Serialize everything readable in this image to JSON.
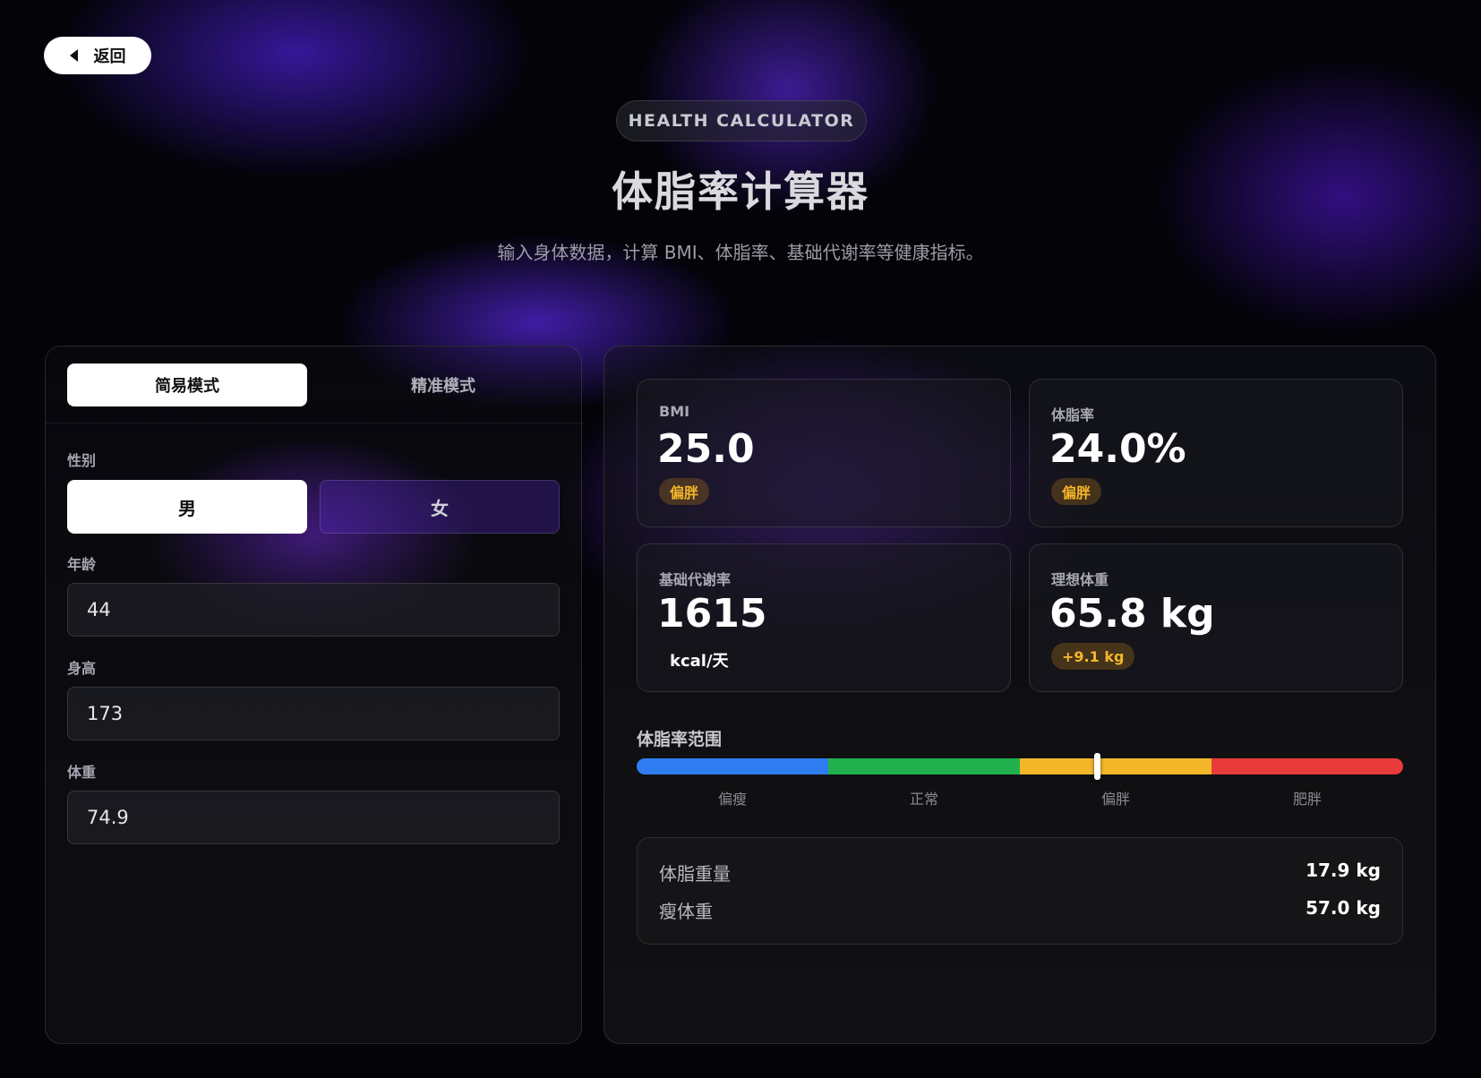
{
  "nav": {
    "back_label": "返回"
  },
  "header": {
    "eyebrow": "HEALTH CALCULATOR",
    "title": "体脂率计算器",
    "subtitle": "输入身体数据，计算 BMI、体脂率、基础代谢率等健康指标。"
  },
  "modes": {
    "simple": "简易模式",
    "precise": "精准模式",
    "selected": "简易模式"
  },
  "form": {
    "gender_label": "性别",
    "gender_options": [
      "男",
      "女"
    ],
    "gender_selected": "男",
    "age_label": "年龄",
    "age_value": "44",
    "height_label": "身高",
    "height_value": "173",
    "weight_label": "体重",
    "weight_value": "74.9"
  },
  "results": {
    "bmi": {
      "label": "BMI",
      "value": "25.0",
      "badge": "偏胖"
    },
    "body_fat": {
      "label": "体脂率",
      "value": "24.0%",
      "badge": "偏胖"
    },
    "bmr": {
      "label": "基础代谢率",
      "value": "1615",
      "unit": "kcal/天"
    },
    "ideal_weight": {
      "label": "理想体重",
      "value": "65.8 kg",
      "badge": "+9.1 kg"
    }
  },
  "range": {
    "title": "体脂率范围",
    "segments": [
      {
        "label": "偏瘦",
        "color": "#2f7cf0"
      },
      {
        "label": "正常",
        "color": "#22b14c"
      },
      {
        "label": "偏胖",
        "color": "#f5b72a"
      },
      {
        "label": "肥胖",
        "color": "#ea3b3b"
      }
    ],
    "marker_fraction": 0.6
  },
  "summary": {
    "fat_mass_label": "体脂重量",
    "fat_mass_value": "17.9 kg",
    "lean_mass_label": "瘦体重",
    "lean_mass_value": "57.0 kg"
  }
}
